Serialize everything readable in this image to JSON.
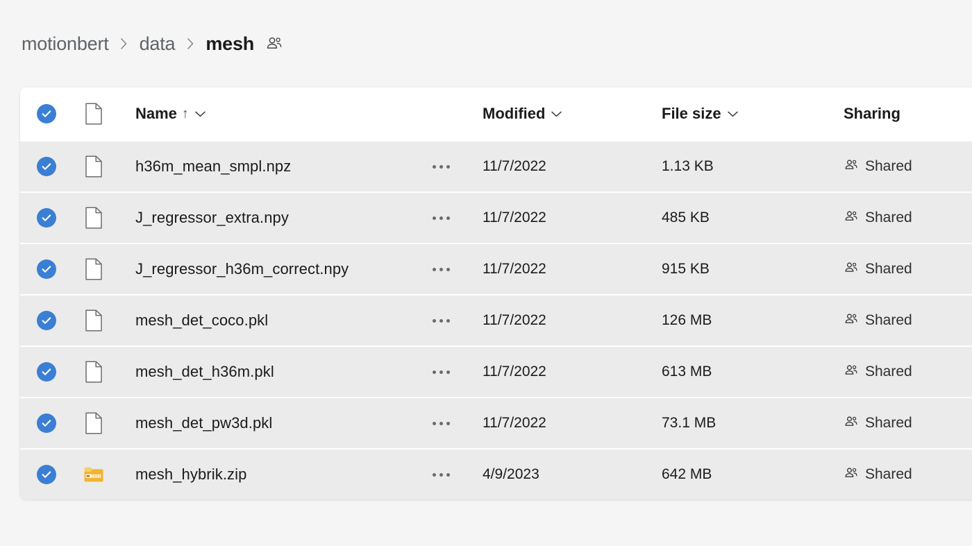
{
  "breadcrumb": {
    "items": [
      {
        "label": "motionbert",
        "current": false
      },
      {
        "label": "data",
        "current": false
      },
      {
        "label": "mesh",
        "current": true
      }
    ],
    "separator": "›",
    "shared_icon": "people-icon"
  },
  "table": {
    "columns": {
      "name": "Name",
      "name_sort_arrow": "↑",
      "modified": "Modified",
      "file_size": "File size",
      "sharing": "Sharing"
    },
    "select_all_checked": true,
    "rows": [
      {
        "name": "h36m_mean_smpl.npz",
        "icon": "file-icon",
        "modified": "11/7/2022",
        "size": "1.13 KB",
        "sharing": "Shared",
        "selected": true
      },
      {
        "name": "J_regressor_extra.npy",
        "icon": "file-icon",
        "modified": "11/7/2022",
        "size": "485 KB",
        "sharing": "Shared",
        "selected": true
      },
      {
        "name": "J_regressor_h36m_correct.npy",
        "icon": "file-icon",
        "modified": "11/7/2022",
        "size": "915 KB",
        "sharing": "Shared",
        "selected": true
      },
      {
        "name": "mesh_det_coco.pkl",
        "icon": "file-icon",
        "modified": "11/7/2022",
        "size": "126 MB",
        "sharing": "Shared",
        "selected": true
      },
      {
        "name": "mesh_det_h36m.pkl",
        "icon": "file-icon",
        "modified": "11/7/2022",
        "size": "613 MB",
        "sharing": "Shared",
        "selected": true
      },
      {
        "name": "mesh_det_pw3d.pkl",
        "icon": "file-icon",
        "modified": "11/7/2022",
        "size": "73.1 MB",
        "sharing": "Shared",
        "selected": true
      },
      {
        "name": "mesh_hybrik.zip",
        "icon": "zip-icon",
        "modified": "4/9/2023",
        "size": "642 MB",
        "sharing": "Shared",
        "selected": true
      }
    ]
  },
  "colors": {
    "accent_blue": "#3b7fd4",
    "page_background": "#f5f5f5",
    "row_selected": "#ebebeb",
    "zip_icon": "#f2b42f"
  }
}
